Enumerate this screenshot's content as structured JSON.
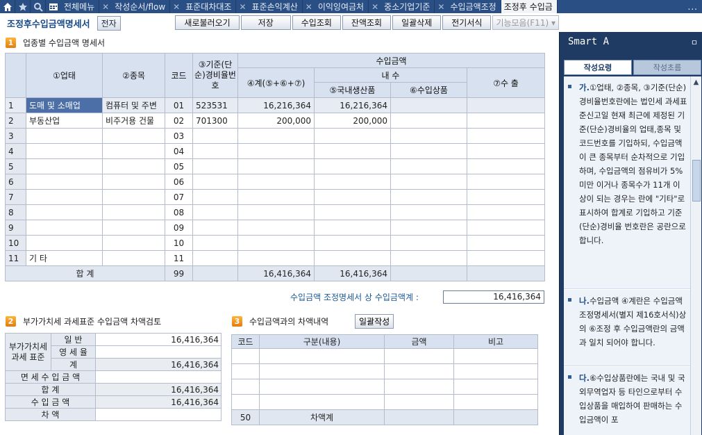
{
  "tabbar": {
    "tabs": [
      {
        "label": "전체메뉴",
        "active": false,
        "closable": false
      },
      {
        "label": "작성순서/flow",
        "active": false,
        "closable": true
      },
      {
        "label": "표준대차대조",
        "active": false,
        "closable": true
      },
      {
        "label": "표준손익계산",
        "active": false,
        "closable": true
      },
      {
        "label": "이익잉여금처",
        "active": false,
        "closable": true
      },
      {
        "label": "중소기업기준",
        "active": false,
        "closable": true
      },
      {
        "label": "수입금액조정",
        "active": false,
        "closable": true
      },
      {
        "label": "조정후 수입금",
        "active": true,
        "closable": true
      }
    ],
    "more": "..."
  },
  "header": {
    "title": "조정후수입금액명세서",
    "badge": "전자"
  },
  "toolbar": {
    "reload": "새로불러오기",
    "save": "저장",
    "import": "수입조회",
    "balance": "잔액조회",
    "delete_all": "일괄삭제",
    "e_form": "전기서식",
    "features": "기능모음(F11)"
  },
  "section1": {
    "num": "1",
    "title": "업종별 수입금액 명세서",
    "headers": {
      "type": "①업태",
      "item": "②종목",
      "code": "코드",
      "rate_code": "③기준(단순)경비율번호",
      "income": "수입금액",
      "total": "④계(⑤+⑥+⑦)",
      "domestic": "내  수",
      "domestic_prod": "⑤국내생산품",
      "import_prod": "⑥수입상품",
      "export": "⑦수  출"
    },
    "rows": [
      {
        "n": "1",
        "type": "도매 및 소매업",
        "item": "컴퓨터 및 주변",
        "code": "01",
        "rate": "523531",
        "total": "16,216,364",
        "domestic": "16,216,364",
        "import": "",
        "export": ""
      },
      {
        "n": "2",
        "type": "부동산업",
        "item": "비주거용 건물",
        "code": "02",
        "rate": "701300",
        "total": "200,000",
        "domestic": "200,000",
        "import": "",
        "export": ""
      },
      {
        "n": "3",
        "type": "",
        "item": "",
        "code": "03",
        "rate": "",
        "total": "",
        "domestic": "",
        "import": "",
        "export": ""
      },
      {
        "n": "4",
        "type": "",
        "item": "",
        "code": "04",
        "rate": "",
        "total": "",
        "domestic": "",
        "import": "",
        "export": ""
      },
      {
        "n": "5",
        "type": "",
        "item": "",
        "code": "05",
        "rate": "",
        "total": "",
        "domestic": "",
        "import": "",
        "export": ""
      },
      {
        "n": "6",
        "type": "",
        "item": "",
        "code": "06",
        "rate": "",
        "total": "",
        "domestic": "",
        "import": "",
        "export": ""
      },
      {
        "n": "7",
        "type": "",
        "item": "",
        "code": "07",
        "rate": "",
        "total": "",
        "domestic": "",
        "import": "",
        "export": ""
      },
      {
        "n": "8",
        "type": "",
        "item": "",
        "code": "08",
        "rate": "",
        "total": "",
        "domestic": "",
        "import": "",
        "export": ""
      },
      {
        "n": "9",
        "type": "",
        "item": "",
        "code": "09",
        "rate": "",
        "total": "",
        "domestic": "",
        "import": "",
        "export": ""
      },
      {
        "n": "10",
        "type": "",
        "item": "",
        "code": "10",
        "rate": "",
        "total": "",
        "domestic": "",
        "import": "",
        "export": ""
      },
      {
        "n": "11",
        "type": "기  타",
        "item": "",
        "code": "11",
        "rate": "",
        "total": "",
        "domestic": "",
        "import": "",
        "export": ""
      }
    ],
    "total_row": {
      "label": "합  계",
      "code": "99",
      "total": "16,416,364",
      "domestic": "16,416,364"
    },
    "summary_label": "수입금액 조정명세서 상 수입금액계 :",
    "summary_value": "16,416,364"
  },
  "section2": {
    "num": "2",
    "title": "부가가치세 과세표준 수입금액 차액검토",
    "vat_label": "부가가치세 과세 표준",
    "general": "일  반",
    "general_value": "16,416,364",
    "zero_rate": "영 세 율",
    "zero_value": "",
    "sub_total": "계",
    "sub_total_value": "16,416,364",
    "exempt": "면 세 수 입 금 액",
    "exempt_value": "",
    "sum": "합          계",
    "sum_value": "16,416,364",
    "income": "수   입   금   액",
    "income_value": "16,416,364",
    "diff": "차          액",
    "diff_value": ""
  },
  "section3": {
    "num": "3",
    "title": "수입금액과의 차액내역",
    "button": "일괄작성",
    "headers": {
      "code": "코드",
      "desc": "구분(내용)",
      "amount": "금액",
      "note": "비고"
    },
    "total_code": "50",
    "total_label": "차액계"
  },
  "smart": {
    "title": "Smart A",
    "pin": "ㅁ",
    "tab_on": "작성요령",
    "tab_off": "작성초름",
    "notes": [
      {
        "lead": "가.",
        "text": "①업태, ②종목, ③기준(단순)경비율번호란에는 법인세 과세표준신고일 현재 최근에 제정된 기준(단순)경비율의 업태,종목 및 코드번호를 기입하되, 수입금액이 큰 종목부터 순차적으로 기입하며, 수입금액의 점유비가 5%미만 이거나 종목수가 11개 이상이 되는 경우는 란에 \"기타\"로 표시하여 합계로 기입하고 기준(단순)경비율 번호란은 공란으로 합니다."
      },
      {
        "lead": "나.",
        "text": "수입금액 ④계란은 수입금액조정명세서(별지 제16호서식)상의 ⑥조정 후 수입금액란의 금액과 일치 되어야 합니다."
      },
      {
        "lead": "다.",
        "text": "⑥수입상품란에는 국내 및 국외무역업자 등 타인으로부터 수입상품을 매입하여 판매하는 수입금액이 포"
      }
    ]
  }
}
